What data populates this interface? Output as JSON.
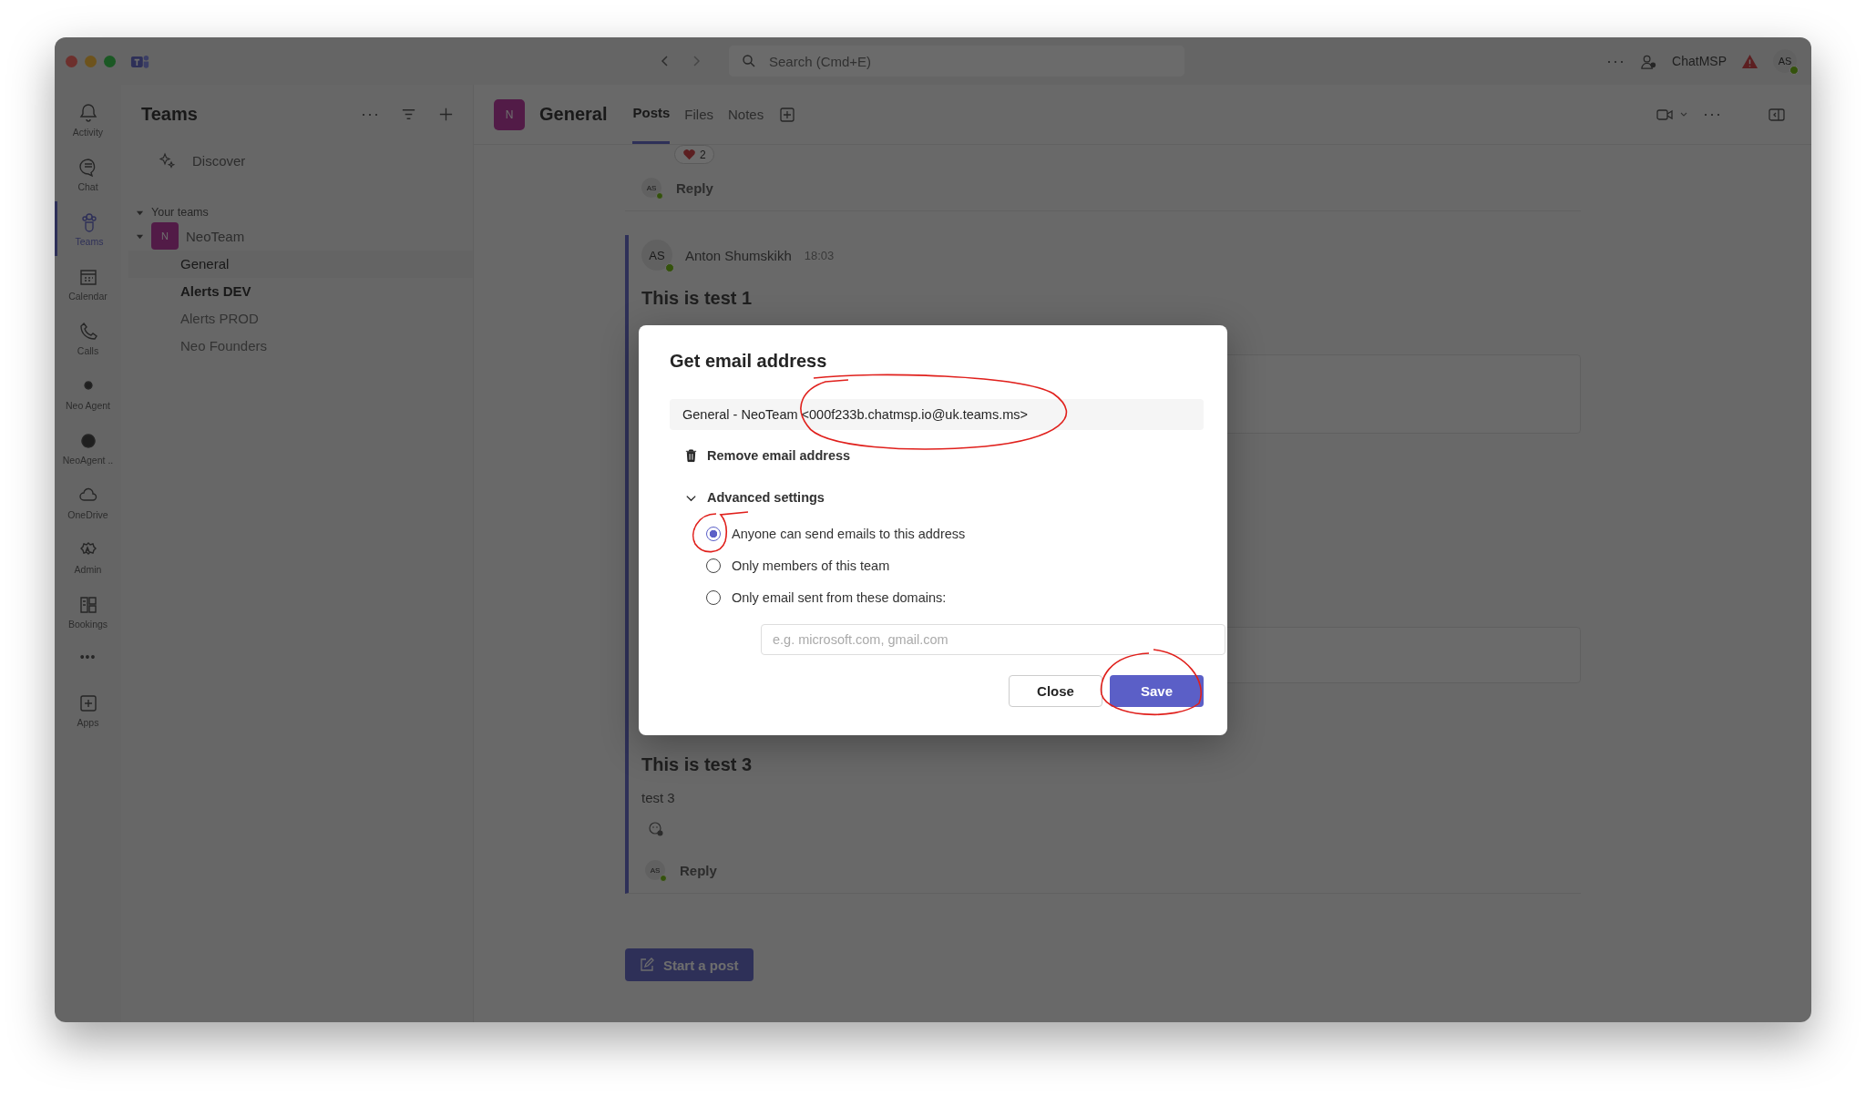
{
  "title_bar": {
    "search": {
      "placeholder": "Search (Cmd+E)"
    },
    "more": "···",
    "org": "ChatMSP",
    "avatar": "AS"
  },
  "rail": {
    "items": [
      {
        "label": "Activity",
        "selected": false
      },
      {
        "label": "Chat",
        "selected": false
      },
      {
        "label": "Teams",
        "selected": true
      },
      {
        "label": "Calendar",
        "selected": false
      },
      {
        "label": "Calls",
        "selected": false
      },
      {
        "label": "Neo Agent",
        "selected": false
      },
      {
        "label": "NeoAgent ..",
        "selected": false
      },
      {
        "label": "OneDrive",
        "selected": false
      },
      {
        "label": "Admin",
        "selected": false
      },
      {
        "label": "Bookings",
        "selected": false
      }
    ],
    "more": "•••",
    "apps": "Apps"
  },
  "teams_panel": {
    "title": "Teams",
    "more": "···",
    "discover": "Discover",
    "section": {
      "label": "Your teams",
      "expanded": true
    },
    "teams": [
      {
        "name": "NeoTeam",
        "avatar": "N",
        "expanded": true,
        "channels": [
          {
            "name": "General",
            "selected": true,
            "unread": false
          },
          {
            "name": "Alerts DEV",
            "selected": false,
            "unread": true
          },
          {
            "name": "Alerts PROD",
            "selected": false,
            "unread": false
          },
          {
            "name": "Neo Founders",
            "selected": false,
            "unread": false
          }
        ]
      }
    ]
  },
  "channel": {
    "avatar": "N",
    "name": "General",
    "tabs": [
      {
        "label": "Posts",
        "selected": true
      },
      {
        "label": "Files",
        "selected": false
      },
      {
        "label": "Notes",
        "selected": false
      }
    ],
    "more": "···"
  },
  "posts": [
    {
      "reaction_count": "2",
      "reply_avatar": "AS",
      "reply_label": "Reply"
    },
    {
      "avatar": "AS",
      "author": "Anton Shumskikh",
      "time": "18:03",
      "title": "This is test 1"
    },
    {
      "title": "This is test 3",
      "body": "test 3",
      "reply_avatar": "AS",
      "reply_label": "Reply"
    }
  ],
  "start_post": "Start a post",
  "dialog": {
    "title": "Get email address",
    "email": "General - NeoTeam <000f233b.chatmsp.io@uk.teams.ms>",
    "remove": "Remove email address",
    "advanced": {
      "label": "Advanced settings",
      "expanded": true
    },
    "options": [
      {
        "label": "Anyone can send emails to this address",
        "selected": true
      },
      {
        "label": "Only members of this team",
        "selected": false
      },
      {
        "label": "Only email sent from these domains:",
        "selected": false
      }
    ],
    "domains": {
      "placeholder": "e.g. microsoft.com, gmail.com"
    },
    "buttons": [
      {
        "label": "Close",
        "kind": "secondary"
      },
      {
        "label": "Save",
        "kind": "primary"
      }
    ]
  }
}
